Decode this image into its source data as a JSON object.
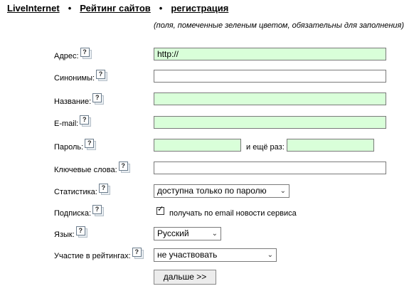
{
  "nav": {
    "links": [
      "LiveInternet",
      "Рейтинг сайтов",
      "регистрация"
    ],
    "separator": "•"
  },
  "note": "(поля, помеченные зеленым цветом, обязательны для заполнения)",
  "help_glyph": "?",
  "form": {
    "address": {
      "label": "Адрес:",
      "value": "http://",
      "required": true
    },
    "synonyms": {
      "label": "Синонимы:",
      "value": "",
      "required": false
    },
    "name": {
      "label": "Название:",
      "value": "",
      "required": true
    },
    "email": {
      "label": "E-mail:",
      "value": "",
      "required": true
    },
    "password": {
      "label": "Пароль:",
      "again_label": "и ещё раз:",
      "required": true
    },
    "keywords": {
      "label": "Ключевые слова:",
      "value": ""
    },
    "stats": {
      "label": "Статистика:",
      "selected": "доступна только по паролю"
    },
    "subscription": {
      "label": "Подписка:",
      "checkbox_label": "получать по email новости сервиса",
      "checked": true
    },
    "language": {
      "label": "Язык:",
      "selected": "Русский"
    },
    "ratings": {
      "label": "Участие в рейтингах:",
      "selected": "не участвовать"
    },
    "submit_label": "дальше >>"
  },
  "colors": {
    "required_bg": "#d9ffd9"
  }
}
